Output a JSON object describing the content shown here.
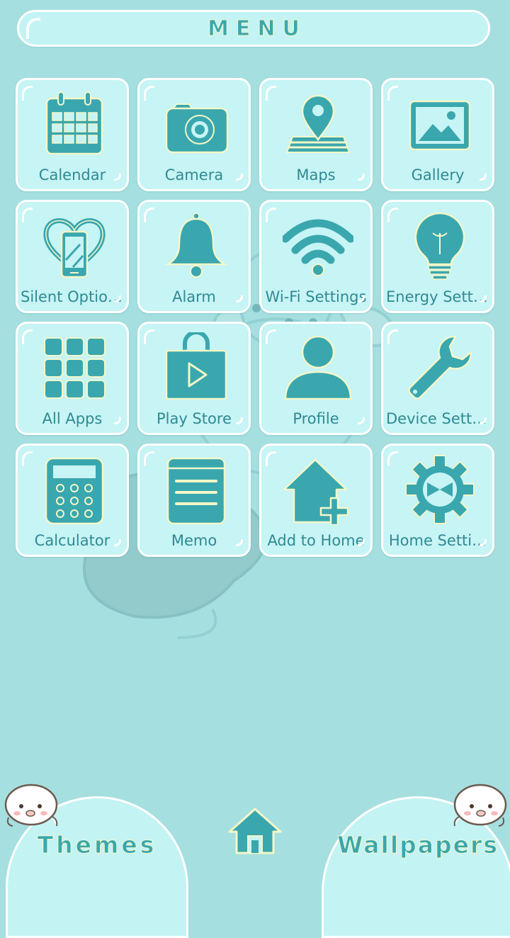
{
  "header": {
    "title": "MENU"
  },
  "apps": [
    {
      "label": "Calendar",
      "icon": "calendar-icon"
    },
    {
      "label": "Camera",
      "icon": "camera-icon"
    },
    {
      "label": "Maps",
      "icon": "map-pin-icon"
    },
    {
      "label": "Gallery",
      "icon": "image-icon"
    },
    {
      "label": "Silent Options",
      "icon": "silent-phone-icon"
    },
    {
      "label": "Alarm",
      "icon": "bell-icon"
    },
    {
      "label": "Wi-Fi Settings",
      "icon": "wifi-icon"
    },
    {
      "label": "Energy Setti…",
      "icon": "light-bulb-icon"
    },
    {
      "label": "All Apps",
      "icon": "app-grid-icon"
    },
    {
      "label": "Play Store",
      "icon": "shopping-bag-play-icon"
    },
    {
      "label": "Profile",
      "icon": "person-icon"
    },
    {
      "label": "Device Setti…",
      "icon": "wrench-icon"
    },
    {
      "label": "Calculator",
      "icon": "calculator-icon"
    },
    {
      "label": "Memo",
      "icon": "memo-icon"
    },
    {
      "label": "Add to Home",
      "icon": "add-home-icon"
    },
    {
      "label": "Home Setti…",
      "icon": "gear-icon"
    }
  ],
  "bottom": {
    "themes_label": "Themes",
    "wallpapers_label": "Wallpapers",
    "home_icon": "home-icon"
  },
  "colors": {
    "background": "#a6dfe0",
    "tile": "#c7f4f5",
    "icon": "#3aa7ae",
    "icon_outline": "#f3f7c8",
    "label": "#2f8a93"
  }
}
